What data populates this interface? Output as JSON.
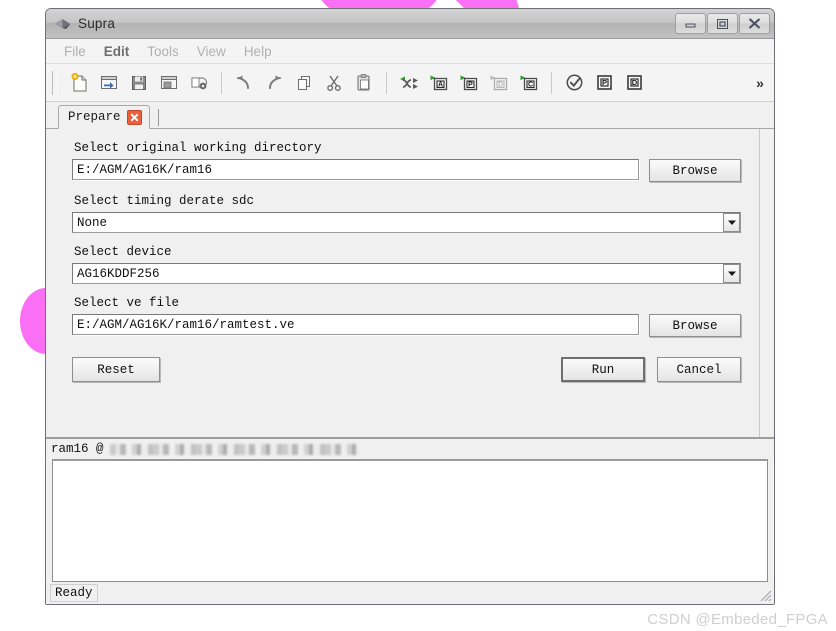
{
  "window": {
    "title": "Supra",
    "app_icon": "diamond-icon",
    "controls": {
      "minimize": "minimize-icon",
      "maximize": "maximize-icon",
      "close": "close-icon"
    }
  },
  "menubar": {
    "items": [
      {
        "label": "File",
        "active": false
      },
      {
        "label": "Edit",
        "active": true
      },
      {
        "label": "Tools",
        "active": false
      },
      {
        "label": "View",
        "active": false
      },
      {
        "label": "Help",
        "active": false
      }
    ]
  },
  "toolbar": {
    "groups": [
      [
        "new-file-icon",
        "open-project-icon",
        "save-icon",
        "save-as-icon",
        "project-settings-icon"
      ],
      [
        "undo-icon",
        "redo-icon",
        "duplicate-icon",
        "cut-icon",
        "paste-icon"
      ],
      [
        "run-all-icon",
        "run-analysis-icon",
        "run-place-icon",
        "run-design-icon",
        "run-compile-icon"
      ],
      [
        "check-icon",
        "report-place-icon",
        "report-design-icon"
      ]
    ],
    "overflow_label": "»"
  },
  "tabs": [
    {
      "label": "Prepare",
      "close_icon": "close-tab-icon",
      "active": true
    }
  ],
  "form": {
    "fields": [
      {
        "label": "Select original working directory",
        "type": "text-with-browse",
        "value": "E:/AGM/AG16K/ram16",
        "button_label": "Browse"
      },
      {
        "label": "Select timing derate sdc",
        "type": "combo",
        "value": "None"
      },
      {
        "label": "Select device",
        "type": "combo",
        "value": "AG16KDDF256"
      },
      {
        "label": "Select ve file",
        "type": "text-with-browse",
        "value": "E:/AGM/AG16K/ram16/ramtest.ve",
        "button_label": "Browse"
      }
    ],
    "buttons": {
      "reset": "Reset",
      "run": "Run",
      "cancel": "Cancel"
    }
  },
  "console": {
    "header_prefix": "ram16 @",
    "header_redacted": true,
    "body_text": ""
  },
  "statusbar": {
    "text": "Ready"
  },
  "watermark": {
    "text": "CSDN @Embeded_FPGA"
  },
  "colors": {
    "accent_pink": "#fb6ff4",
    "tab_close_red": "#e8603c",
    "run_marker_green": "#2e9b2e",
    "window_bg": "#f0f0f0",
    "titlebar_gray": "#c6c6c6"
  }
}
